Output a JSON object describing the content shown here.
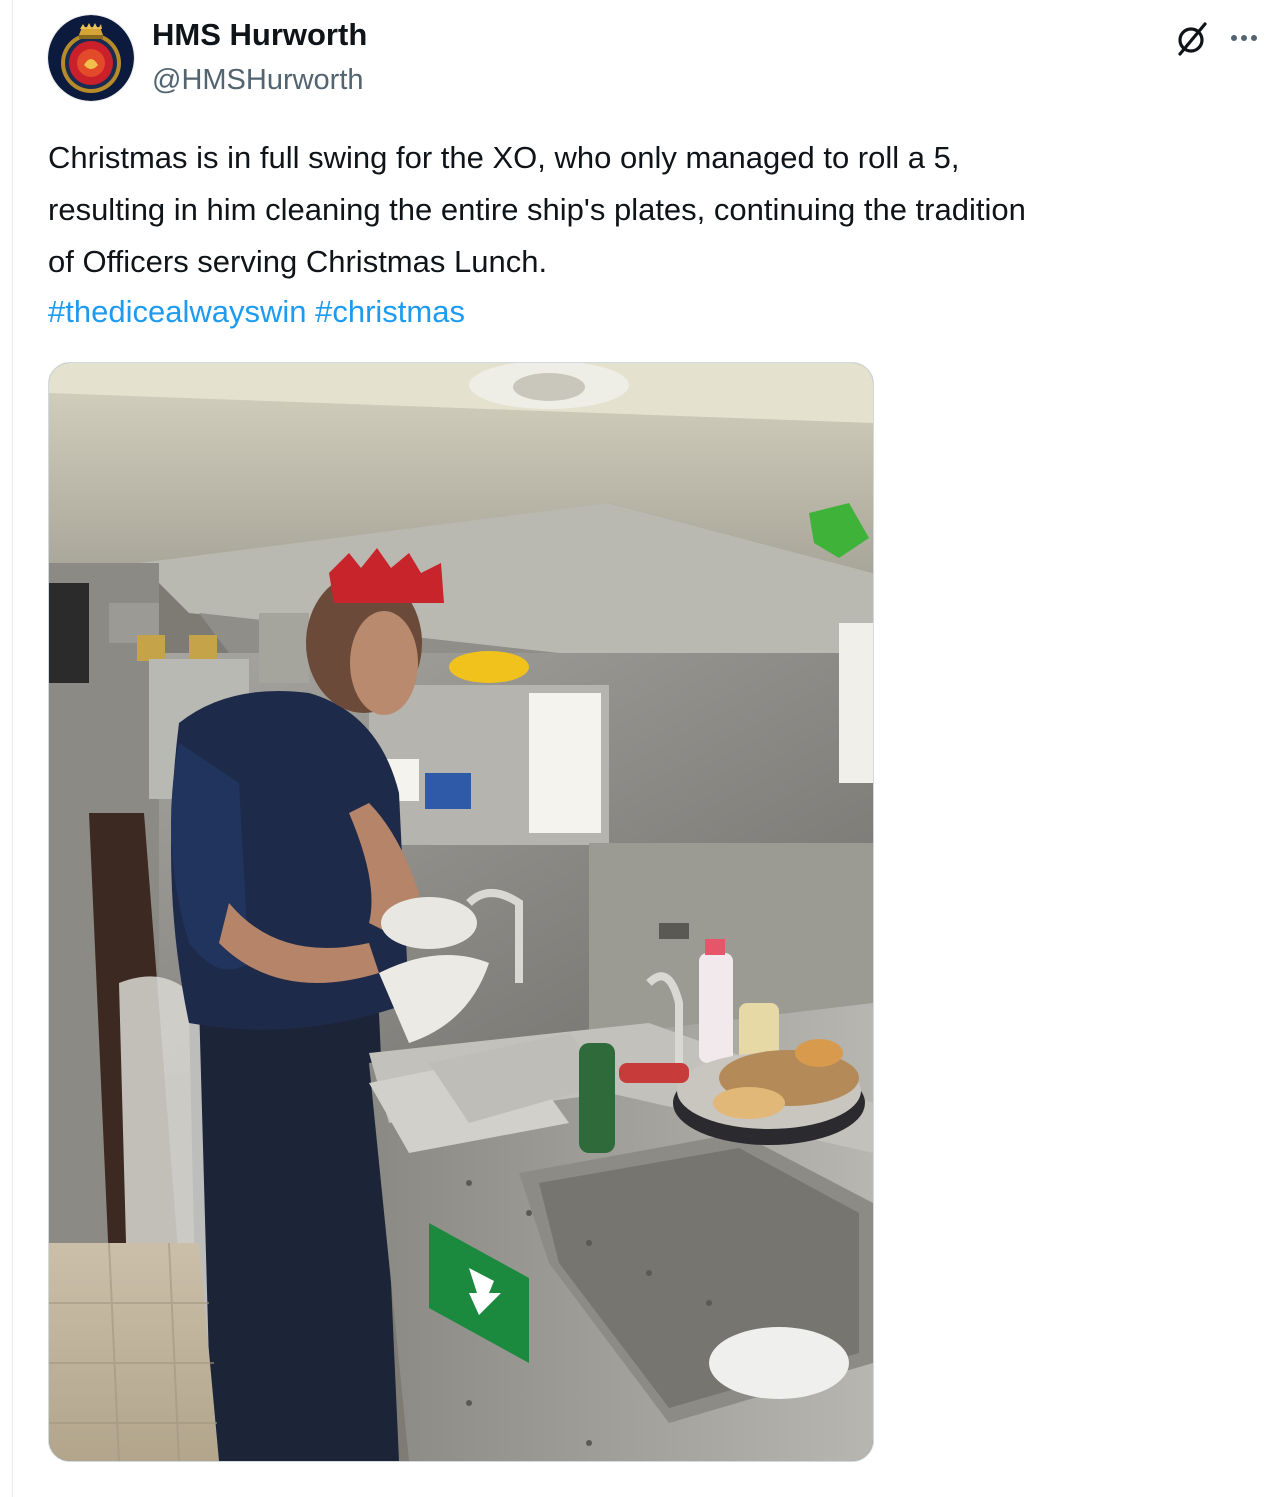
{
  "tweet": {
    "author": {
      "display_name": "HMS Hurworth",
      "handle": "@HMSHurworth",
      "avatar_icon": "ship-crest-icon"
    },
    "text_lines": [
      "Christmas is in full swing for the XO, who only managed to roll a 5,",
      "resulting in him cleaning the entire ship's plates, continuing the tradition",
      "of Officers serving Christmas Lunch."
    ],
    "hashtags": [
      "#thedicealwayswin",
      "#christmas"
    ],
    "actions": {
      "grok_icon": "grok-icon",
      "more_icon": "more-dots-icon"
    },
    "media": {
      "kind": "photo",
      "icon": "galley-photo"
    }
  },
  "colors": {
    "text": "#0f1419",
    "secondary": "#536471",
    "link": "#1d9bf0",
    "border": "#cfd9de"
  }
}
